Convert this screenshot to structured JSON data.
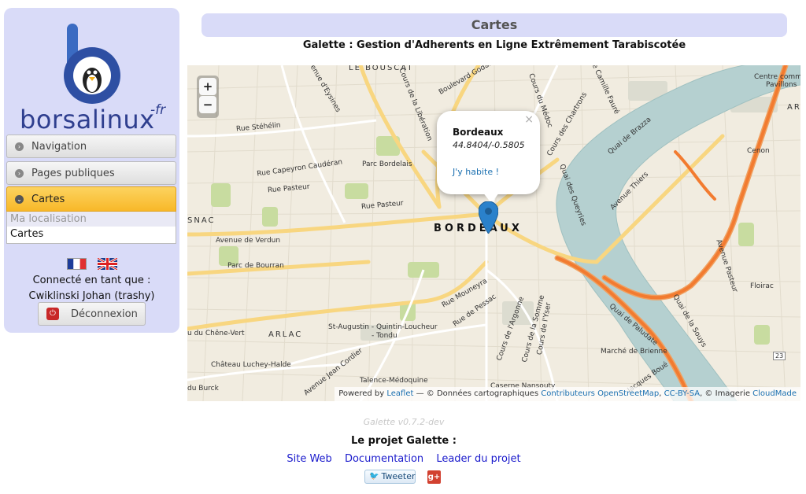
{
  "sidebar": {
    "logo_text": "borsalinux",
    "logo_suffix": "-fr",
    "menu": {
      "navigation": "Navigation",
      "pages_publiques": "Pages publiques",
      "cartes": "Cartes",
      "submenu": [
        "Ma localisation",
        "Cartes"
      ]
    },
    "flags": [
      "flag-fr-icon",
      "flag-uk-icon"
    ],
    "connected_label": "Connecté en tant que :",
    "user": "Cwiklinski Johan (trashy)",
    "logout_label": "Déconnexion"
  },
  "header": {
    "title": "Cartes",
    "subtitle": "Galette : Gestion d'Adherents en Ligne Extrêmement Tarabiscotée"
  },
  "map": {
    "zoom_in": "+",
    "zoom_out": "−",
    "popup": {
      "close": "×",
      "city": "Bordeaux",
      "coords": "44.8404/-0.5805",
      "link": "J'y habite !"
    },
    "labels": {
      "le_bouscat": "LE BOUSCAT",
      "bordeaux": "BORDEAUX",
      "arlac": "ARLAC",
      "mignac": "SNAC",
      "ar": "AR",
      "centre_commercial": "Centre commercial",
      "pavillons": "Pavillons",
      "cenon": "Cenon",
      "floirac": "Floirac",
      "parc_bordelais": "Parc Bordelais",
      "parc_bourran": "Parc de Bourran",
      "rue_caudéran": "Rue Capeyron Caudéran",
      "rue_stehelin": "Rue Stéhélin",
      "rue_pasteur": "Rue Pasteur",
      "rue_pasteur2": "Rue Pasteur",
      "avenue_verdun": "Avenue de Verdun",
      "avenue_eysines": "Avenue d'Eysines",
      "cours_liberation": "Cours de la Libération",
      "cours_medoc": "Cours du Médoc",
      "rue_fauré": "Rue Camille Fauré",
      "cours_chartrons": "Cours des Chartrons",
      "quai_brazza": "Quai de Brazza",
      "quai_queyries": "Quai des Queyries",
      "avenue_thiers": "Avenue Thiers",
      "avenue_pasteur": "Avenue Pasteur",
      "quai_souys": "Quai de la Souys",
      "quai_paludate": "Quai de Paludate",
      "marche_brienne": "Marché de Brienne",
      "st_augustin": "St-Augustin - Quintin-Loucheur",
      "tondu": "- Tondu",
      "rue_mouneyra": "Rue Mouneyra",
      "rue_pessac": "Rue de Pessac",
      "cours_argonne": "Cours de l'Argonne",
      "cours_somme": "Cours de la Somme",
      "cours_yser": "Cours de l'Yser",
      "chene_vert": "u du Chêne-Vert",
      "chateau_luchey": "Château Luchey-Halde",
      "av_jean_cordier": "Avenue Jean Cordier",
      "talence": "Talence-Médoquine",
      "du_burck": "du Burck",
      "caserne": "Caserne Nansouty",
      "bvd_godard": "Boulevard Godard",
      "rue_jacques": "Jacques Boué",
      "road_23": "23"
    },
    "attribution": {
      "powered": "Powered by",
      "leaflet": "Leaflet",
      "donnees": "— © Données cartographiques",
      "osm": "Contributeurs OpenStreetMap",
      "sep": ",",
      "license": "CC-BY-SA",
      "imagerie": ", © Imagerie",
      "cloudmade": "CloudMade"
    }
  },
  "footer": {
    "version": "Galette v0.7.2-dev",
    "project": "Le projet Galette :",
    "links": [
      "Site Web",
      "Documentation",
      "Leader du projet"
    ],
    "tweet": "Tweeter",
    "gplus": "g+"
  },
  "colors": {
    "panel_bg": "#d9dbf8",
    "active_menu": "#f8b829",
    "link": "#1a1acc",
    "map_bg": "#f1ece0",
    "river": "#b5d0d0",
    "marker": "#2a81cb"
  }
}
